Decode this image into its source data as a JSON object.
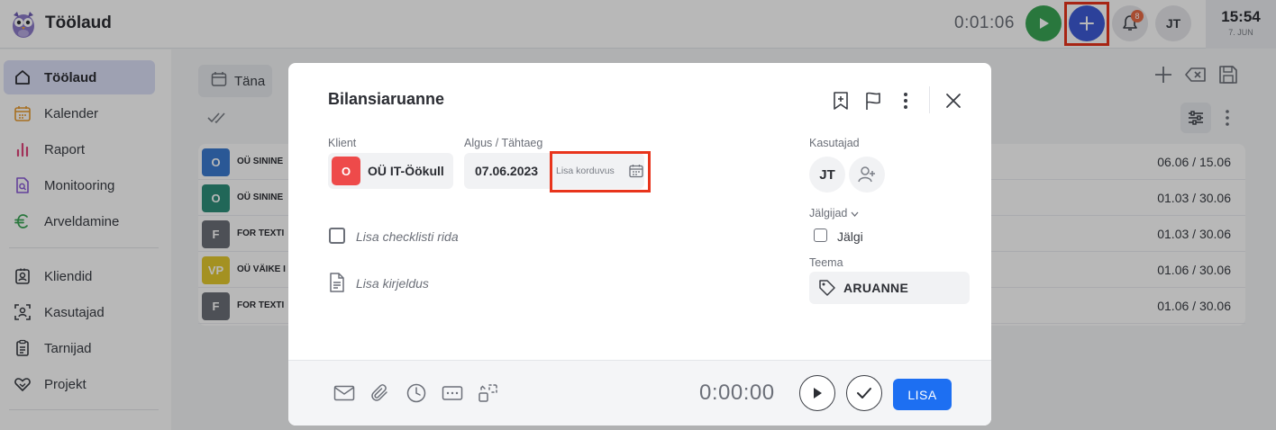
{
  "app": {
    "title": "Töölaud"
  },
  "topbar": {
    "timer": "0:01:06",
    "notification_count": "8",
    "user_initials": "JT",
    "clock_time": "15:54",
    "clock_date": "7. JUN"
  },
  "sidebar": {
    "items": [
      {
        "label": "Töölaud",
        "icon": "home-icon"
      },
      {
        "label": "Kalender",
        "icon": "calendar-icon"
      },
      {
        "label": "Raport",
        "icon": "bar-chart-icon"
      },
      {
        "label": "Monitooring",
        "icon": "monitor-search-icon"
      },
      {
        "label": "Arveldamine",
        "icon": "euro-icon"
      },
      {
        "label": "Kliendid",
        "icon": "contact-card-icon"
      },
      {
        "label": "Kasutajad",
        "icon": "user-scan-icon"
      },
      {
        "label": "Tarnijad",
        "icon": "clipboard-icon"
      },
      {
        "label": "Projekt",
        "icon": "handshake-heart-icon"
      }
    ]
  },
  "main": {
    "today_label": "Täna",
    "rows": [
      {
        "tag": "O",
        "color": "#3b7bd0",
        "name": "OÜ SININE",
        "start": "06.06",
        "end": "15.06"
      },
      {
        "tag": "O",
        "color": "#2f8f7a",
        "name": "OÜ SININE",
        "start": "01.03",
        "end": "30.06"
      },
      {
        "tag": "F",
        "color": "#6b6f78",
        "name": "FOR TEXTI",
        "start": "01.03",
        "end": "30.06"
      },
      {
        "tag": "VP",
        "color": "#e3c92e",
        "name": "OÜ VÄIKE I",
        "start": "01.06",
        "end": "30.06"
      },
      {
        "tag": "F",
        "color": "#6b6f78",
        "name": "FOR TEXTI",
        "start": "01.06",
        "end": "30.06"
      }
    ]
  },
  "modal": {
    "title": "Bilansiaruanne",
    "client_label": "Klient",
    "client_initial": "O",
    "client_name": "OÜ IT-Öökull",
    "date_label": "Algus / Tähtaeg",
    "date_value": "07.06.2023",
    "recurrence_label": "Lisa korduvus",
    "checklist_placeholder": "Lisa checklisti rida",
    "description_placeholder": "Lisa kirjeldus",
    "users_label": "Kasutajad",
    "user_initials": "JT",
    "followers_label": "Jälgijad",
    "follow_label": "Jälgi",
    "theme_label": "Teema",
    "theme_value": "ARUANNE",
    "timer": "0:00:00",
    "add_button": "LISA"
  },
  "colors": {
    "accent": "#1d6ff2",
    "highlight": "#e8341c",
    "play_green": "#3aa655",
    "plus_blue": "#3d5bd6"
  }
}
